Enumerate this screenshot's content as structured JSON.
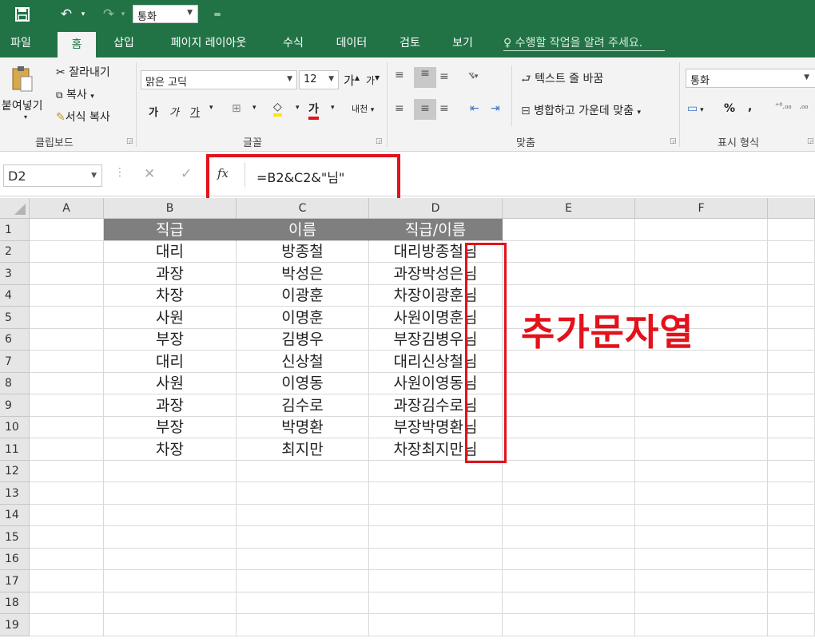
{
  "quick_access": {
    "save_icon": "save-icon",
    "undo_icon": "undo-icon",
    "redo_icon": "redo-icon",
    "number_format_value": "통화",
    "customize_icon": "customize-quick-access-icon"
  },
  "tabs": [
    {
      "label": "파일",
      "active": false
    },
    {
      "label": "홈",
      "active": true
    },
    {
      "label": "삽입",
      "active": false
    },
    {
      "label": "페이지 레이아웃",
      "active": false
    },
    {
      "label": "수식",
      "active": false
    },
    {
      "label": "데이터",
      "active": false
    },
    {
      "label": "검토",
      "active": false
    },
    {
      "label": "보기",
      "active": false
    }
  ],
  "tell_me": "수행할 작업을 알려 주세요.",
  "ribbon": {
    "clipboard": {
      "paste": "붙여넣기",
      "cut": "잘라내기",
      "copy": "복사",
      "format_painter": "서식 복사",
      "label": "클립보드"
    },
    "font": {
      "font_name": "맑은 고딕",
      "font_size": "12",
      "grow": "가",
      "shrink": "가",
      "bold": "가",
      "italic": "가",
      "underline": "가",
      "font_color": "가",
      "phonetic": "내천",
      "label": "글꼴"
    },
    "alignment": {
      "wrap_text": "텍스트 줄 바꿈",
      "merge_center": "병합하고 가운데 맞춤",
      "label": "맞춤"
    },
    "number": {
      "format": "통화",
      "percent": "%",
      "comma": ",",
      "label": "표시 형식"
    }
  },
  "formula_bar": {
    "name_box": "D2",
    "fx": "fx",
    "formula": "=B2&C2&\"님\""
  },
  "columns": [
    "A",
    "B",
    "C",
    "D",
    "E",
    "F"
  ],
  "rows": [
    {
      "num": "1",
      "B": "직급",
      "C": "이름",
      "D": "직급/이름"
    },
    {
      "num": "2",
      "B": "대리",
      "C": "방종철",
      "D": "대리방종철님"
    },
    {
      "num": "3",
      "B": "과장",
      "C": "박성은",
      "D": "과장박성은님"
    },
    {
      "num": "4",
      "B": "차장",
      "C": "이광훈",
      "D": "차장이광훈님"
    },
    {
      "num": "5",
      "B": "사원",
      "C": "이명훈",
      "D": "사원이명훈님"
    },
    {
      "num": "6",
      "B": "부장",
      "C": "김병우",
      "D": "부장김병우님"
    },
    {
      "num": "7",
      "B": "대리",
      "C": "신상철",
      "D": "대리신상철님"
    },
    {
      "num": "8",
      "B": "사원",
      "C": "이영동",
      "D": "사원이영동님"
    },
    {
      "num": "9",
      "B": "과장",
      "C": "김수로",
      "D": "과장김수로님"
    },
    {
      "num": "10",
      "B": "부장",
      "C": "박명환",
      "D": "부장박명환님"
    },
    {
      "num": "11",
      "B": "차장",
      "C": "최지만",
      "D": "차장최지만님"
    },
    {
      "num": "12",
      "B": "",
      "C": "",
      "D": ""
    },
    {
      "num": "13",
      "B": "",
      "C": "",
      "D": ""
    },
    {
      "num": "14",
      "B": "",
      "C": "",
      "D": ""
    },
    {
      "num": "15",
      "B": "",
      "C": "",
      "D": ""
    },
    {
      "num": "16",
      "B": "",
      "C": "",
      "D": ""
    },
    {
      "num": "17",
      "B": "",
      "C": "",
      "D": ""
    },
    {
      "num": "18",
      "B": "",
      "C": "",
      "D": ""
    },
    {
      "num": "19",
      "B": "",
      "C": "",
      "D": ""
    }
  ],
  "annotation": "추가문자열",
  "colors": {
    "accent": "#217346",
    "header_fill": "#7f7f7f",
    "highlight": "#e3121b"
  }
}
